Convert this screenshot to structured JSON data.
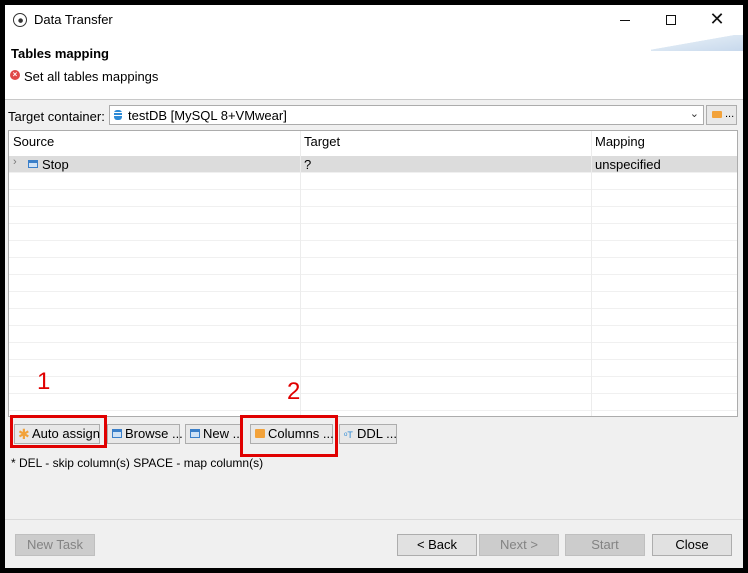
{
  "window": {
    "title": "Data Transfer",
    "controls": {
      "minimize_icon": "minimize-icon",
      "maximize_icon": "maximize-icon",
      "close_glyph": "✕"
    }
  },
  "header": {
    "title": "Tables mapping",
    "message": "Set all tables mappings",
    "message_icon": "error-icon"
  },
  "target_container": {
    "label": "Target container:",
    "value": "testDB  [MySQL 8+VMwear]",
    "icon": "database-icon",
    "browse_label": "..."
  },
  "table": {
    "columns": [
      "Source",
      "Target",
      "Mapping"
    ],
    "rows": [
      {
        "expand": "›",
        "source": "Stop",
        "target": "?",
        "mapping": "unspecified",
        "icon": "table-icon"
      }
    ]
  },
  "actions": {
    "auto_assign": "Auto assign",
    "browse": "Browse ...",
    "new": "New ...",
    "columns": "Columns ...",
    "ddl": "DDL ..."
  },
  "annotations": [
    "1",
    "2"
  ],
  "hint": "* DEL - skip column(s)  SPACE - map column(s)",
  "footer": {
    "new_task": "New Task",
    "back": "< Back",
    "next": "Next >",
    "start": "Start",
    "close": "Close"
  },
  "colors": {
    "annotation": "#e00000",
    "error": "#e04848",
    "selected_row": "#dcdcdc"
  }
}
